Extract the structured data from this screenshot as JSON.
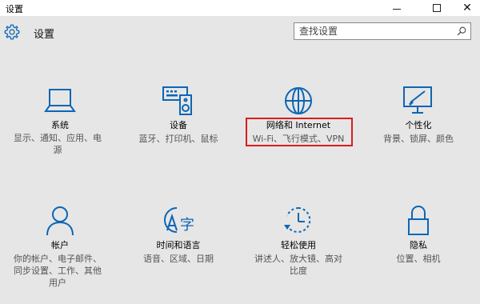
{
  "window": {
    "title": "设置",
    "controls": {
      "minimize": "",
      "maximize": "",
      "close": "✕"
    }
  },
  "header": {
    "title": "设置",
    "icon": "gear-icon"
  },
  "search": {
    "placeholder": "查找设置",
    "icon": "search-icon"
  },
  "accent_color": "#0c66b5",
  "highlight_color": "#d81e1e",
  "categories": [
    {
      "label": "系统",
      "desc": "显示、通知、应用、电源",
      "icon": "laptop-icon"
    },
    {
      "label": "设备",
      "desc": "蓝牙、打印机、鼠标",
      "icon": "keyboard-speaker-icon"
    },
    {
      "label": "网络和 Internet",
      "desc": "Wi-Fi、飞行模式、VPN",
      "icon": "globe-icon",
      "highlighted": true
    },
    {
      "label": "个性化",
      "desc": "背景、锁屏、颜色",
      "icon": "paint-monitor-icon"
    },
    {
      "label": "帐户",
      "desc": "你的帐户、电子邮件、同步设置、工作、其他用户",
      "icon": "person-icon"
    },
    {
      "label": "时间和语言",
      "desc": "语音、区域、日期",
      "icon": "time-language-icon"
    },
    {
      "label": "轻松使用",
      "desc": "讲述人、放大镜、高对比度",
      "icon": "ease-of-access-icon"
    },
    {
      "label": "隐私",
      "desc": "位置、相机",
      "icon": "lock-icon"
    }
  ]
}
